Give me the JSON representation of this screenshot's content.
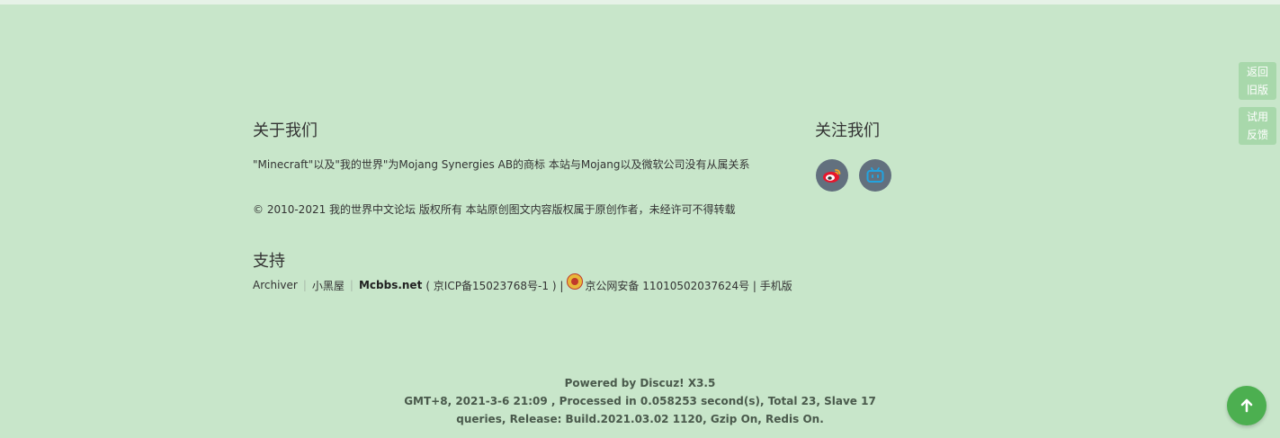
{
  "footer": {
    "about": {
      "title": "关于我们",
      "line1": "\"Minecraft\"以及\"我的世界\"为Mojang Synergies AB的商标 本站与Mojang以及微软公司没有从属关系",
      "line2": "© 2010-2021 我的世界中文论坛 版权所有 本站原创图文内容版权属于原创作者，未经许可不得转载"
    },
    "support": {
      "title": "支持",
      "archiver": "Archiver",
      "blackroom": "小黑屋",
      "site": "Mcbbs.net",
      "icp": "( 京ICP备15023768号-1 ) |",
      "police_record": "京公网安备 11010502037624号 | 手机版"
    },
    "follow": {
      "title": "关注我们",
      "icons": [
        "weibo-icon",
        "bilibili-icon"
      ]
    },
    "powered": {
      "line1": "Powered by Discuz! X3.5",
      "line2": "GMT+8, 2021-3-6 21:09 , Processed in 0.058253 second(s), Total 23, Slave 17",
      "line3": "queries, Release: Build.2021.03.02 1120, Gzip On, Redis On."
    }
  },
  "sidebar": {
    "old_version": [
      "返回",
      "旧版"
    ],
    "feedback": [
      "试用",
      "反馈"
    ]
  },
  "colors": {
    "background": "#c8e6ca",
    "side_button": "#a8d8ab",
    "to_top": "#4caf50",
    "social_bg": "#62707e"
  }
}
